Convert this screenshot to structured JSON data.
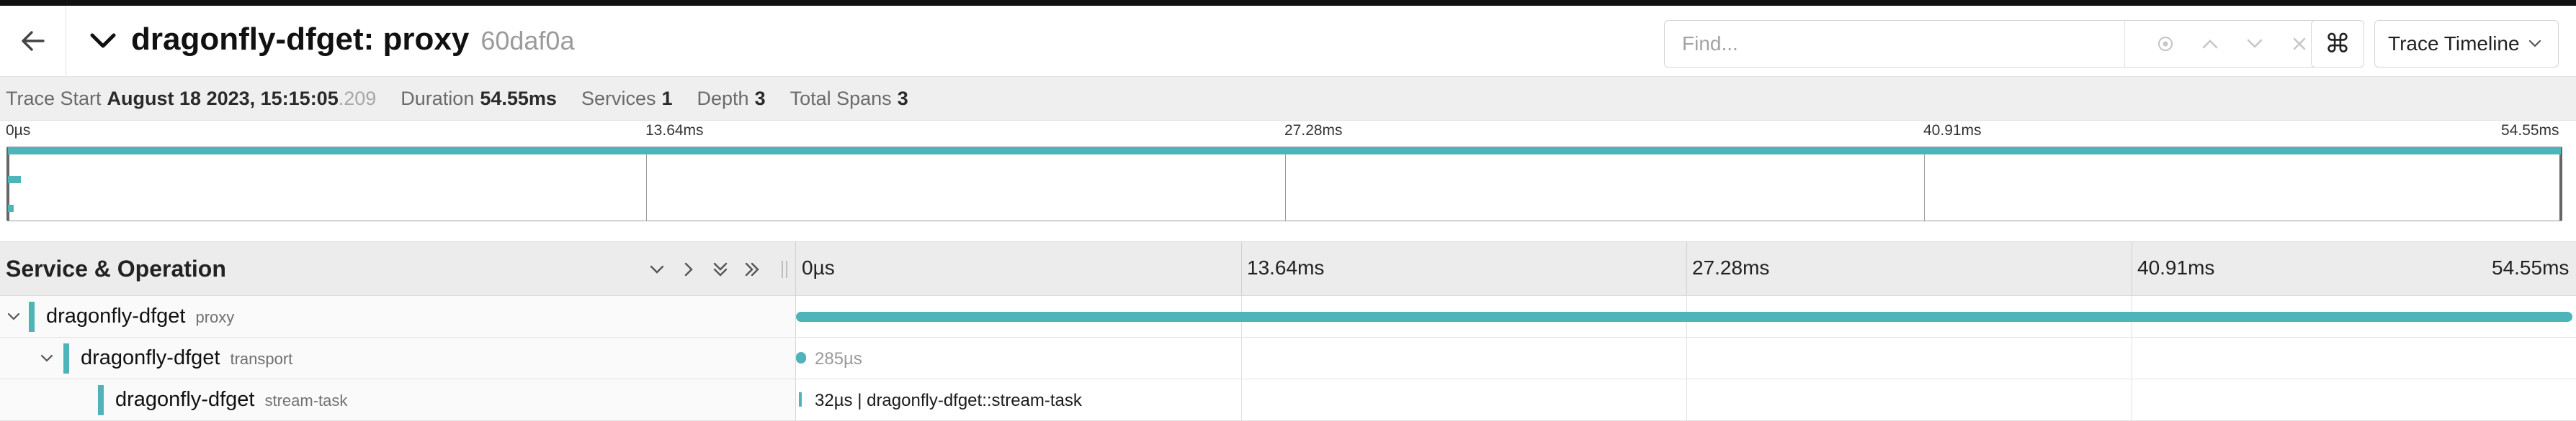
{
  "header": {
    "title_name": "dragonfly-dfget: proxy",
    "trace_id": "60daf0a",
    "find_placeholder": "Find...",
    "cmd_glyph": "⌘",
    "view_label": "Trace Timeline"
  },
  "meta": {
    "trace_start_label": "Trace Start",
    "trace_start_value": "August 18 2023, 15:15:05",
    "trace_start_ms": ".209",
    "duration_label": "Duration",
    "duration_value": "54.55ms",
    "services_label": "Services",
    "services_value": "1",
    "depth_label": "Depth",
    "depth_value": "3",
    "total_spans_label": "Total Spans",
    "total_spans_value": "3"
  },
  "ticks": [
    "0µs",
    "13.64ms",
    "27.28ms",
    "40.91ms",
    "54.55ms"
  ],
  "timeline": {
    "column_title": "Service & Operation"
  },
  "spans": [
    {
      "service": "dragonfly-dfget",
      "operation": "proxy",
      "label": "",
      "start_fraction": 0.0,
      "duration_fraction": 1.0
    },
    {
      "service": "dragonfly-dfget",
      "operation": "transport",
      "label": "285µs",
      "start_fraction": 0.0,
      "duration_fraction": 0.0052
    },
    {
      "service": "dragonfly-dfget",
      "operation": "stream-task",
      "label": "32µs | dragonfly-dfget::stream-task",
      "start_fraction": 0.0,
      "duration_fraction": 0.0006
    }
  ],
  "colors": {
    "span": "#4fb4ba",
    "accent_dark": "#111111"
  },
  "icons": [
    "arrow-left-icon",
    "chevron-down-icon",
    "locate-icon",
    "chevron-up-icon",
    "chevron-down-icon",
    "close-icon",
    "command-icon",
    "chevron-right-icon",
    "double-chevron-down-icon",
    "double-chevron-right-icon"
  ]
}
